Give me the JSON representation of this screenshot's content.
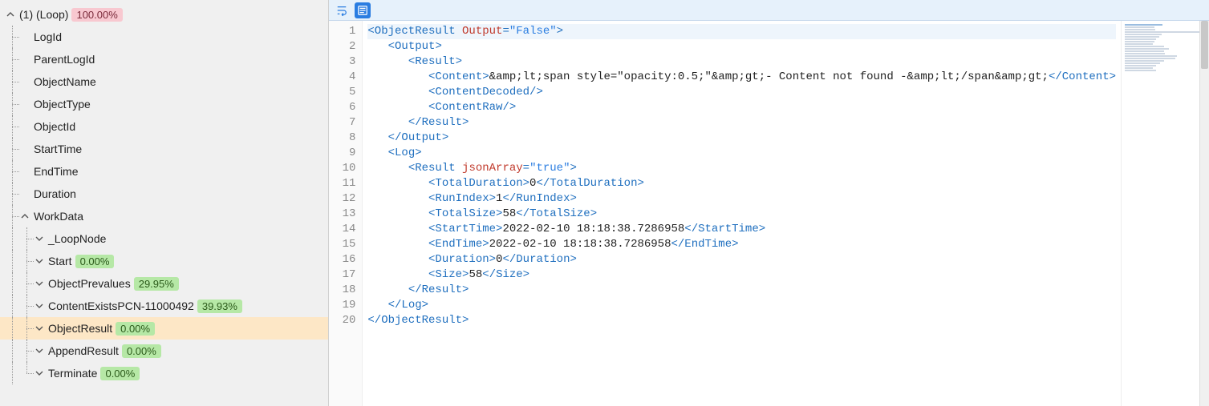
{
  "tree": {
    "root": {
      "label": "(1) (Loop)",
      "badge": {
        "text": "100.00%",
        "color": "pink"
      },
      "expanded": true
    },
    "children_flat": [
      {
        "label": "LogId"
      },
      {
        "label": "ParentLogId"
      },
      {
        "label": "ObjectName"
      },
      {
        "label": "ObjectType"
      },
      {
        "label": "ObjectId"
      },
      {
        "label": "StartTime"
      },
      {
        "label": "EndTime"
      },
      {
        "label": "Duration"
      }
    ],
    "workdata": {
      "label": "WorkData",
      "expanded": true,
      "items": [
        {
          "label": "_LoopNode",
          "collapsed": true
        },
        {
          "label": "Start",
          "badge": {
            "text": "0.00%",
            "color": "green"
          },
          "collapsed": true
        },
        {
          "label": "ObjectPrevalues",
          "badge": {
            "text": "29.95%",
            "color": "green"
          },
          "collapsed": true
        },
        {
          "label": "ContentExistsPCN-11000492",
          "badge": {
            "text": "39.93%",
            "color": "green"
          },
          "collapsed": true
        },
        {
          "label": "ObjectResult",
          "badge": {
            "text": "0.00%",
            "color": "green"
          },
          "collapsed": true,
          "selected": true
        },
        {
          "label": "AppendResult",
          "badge": {
            "text": "0.00%",
            "color": "green"
          },
          "collapsed": true
        },
        {
          "label": "Terminate",
          "badge": {
            "text": "0.00%",
            "color": "green"
          },
          "collapsed": true
        }
      ]
    }
  },
  "xml_data": {
    "ObjectResult": {
      "Output_attr": "False",
      "Output": {
        "Result": {
          "Content": "&amp;lt;span style=\"opacity:0.5;\"&amp;gt;- Content not found -&amp;lt;/span&amp;gt;",
          "ContentDecoded": null,
          "ContentRaw": null
        }
      },
      "Log": {
        "Result": {
          "jsonArray_attr": "true",
          "TotalDuration": "0",
          "RunIndex": "1",
          "TotalSize": "58",
          "StartTime": "2022-02-10 18:18:38.7286958",
          "EndTime": "2022-02-10 18:18:38.7286958",
          "Duration": "0",
          "Size": "58"
        }
      }
    }
  },
  "editor": {
    "line_count": 20,
    "lines_tokens": [
      [
        [
          "br",
          "<"
        ],
        [
          "tag",
          "ObjectResult"
        ],
        [
          "text",
          " "
        ],
        [
          "attr",
          "Output"
        ],
        [
          "br",
          "="
        ],
        [
          "str",
          "\"False\""
        ],
        [
          "br",
          ">"
        ]
      ],
      [
        [
          "text",
          "   "
        ],
        [
          "br",
          "<"
        ],
        [
          "tag",
          "Output"
        ],
        [
          "br",
          ">"
        ]
      ],
      [
        [
          "text",
          "      "
        ],
        [
          "br",
          "<"
        ],
        [
          "tag",
          "Result"
        ],
        [
          "br",
          ">"
        ]
      ],
      [
        [
          "text",
          "         "
        ],
        [
          "br",
          "<"
        ],
        [
          "tag",
          "Content"
        ],
        [
          "br",
          ">"
        ],
        [
          "text",
          "&amp;lt;span style=\"opacity:0.5;\"&amp;gt;- Content not found -&amp;lt;/span&amp;gt;"
        ],
        [
          "br",
          "</"
        ],
        [
          "tag",
          "Content"
        ],
        [
          "br",
          ">"
        ]
      ],
      [
        [
          "text",
          "         "
        ],
        [
          "br",
          "<"
        ],
        [
          "tag",
          "ContentDecoded"
        ],
        [
          "br",
          "/>"
        ]
      ],
      [
        [
          "text",
          "         "
        ],
        [
          "br",
          "<"
        ],
        [
          "tag",
          "ContentRaw"
        ],
        [
          "br",
          "/>"
        ]
      ],
      [
        [
          "text",
          "      "
        ],
        [
          "br",
          "</"
        ],
        [
          "tag",
          "Result"
        ],
        [
          "br",
          ">"
        ]
      ],
      [
        [
          "text",
          "   "
        ],
        [
          "br",
          "</"
        ],
        [
          "tag",
          "Output"
        ],
        [
          "br",
          ">"
        ]
      ],
      [
        [
          "text",
          "   "
        ],
        [
          "br",
          "<"
        ],
        [
          "tag",
          "Log"
        ],
        [
          "br",
          ">"
        ]
      ],
      [
        [
          "text",
          "      "
        ],
        [
          "br",
          "<"
        ],
        [
          "tag",
          "Result"
        ],
        [
          "text",
          " "
        ],
        [
          "attr",
          "jsonArray"
        ],
        [
          "br",
          "="
        ],
        [
          "str",
          "\"true\""
        ],
        [
          "br",
          ">"
        ]
      ],
      [
        [
          "text",
          "         "
        ],
        [
          "br",
          "<"
        ],
        [
          "tag",
          "TotalDuration"
        ],
        [
          "br",
          ">"
        ],
        [
          "text",
          "0"
        ],
        [
          "br",
          "</"
        ],
        [
          "tag",
          "TotalDuration"
        ],
        [
          "br",
          ">"
        ]
      ],
      [
        [
          "text",
          "         "
        ],
        [
          "br",
          "<"
        ],
        [
          "tag",
          "RunIndex"
        ],
        [
          "br",
          ">"
        ],
        [
          "text",
          "1"
        ],
        [
          "br",
          "</"
        ],
        [
          "tag",
          "RunIndex"
        ],
        [
          "br",
          ">"
        ]
      ],
      [
        [
          "text",
          "         "
        ],
        [
          "br",
          "<"
        ],
        [
          "tag",
          "TotalSize"
        ],
        [
          "br",
          ">"
        ],
        [
          "text",
          "58"
        ],
        [
          "br",
          "</"
        ],
        [
          "tag",
          "TotalSize"
        ],
        [
          "br",
          ">"
        ]
      ],
      [
        [
          "text",
          "         "
        ],
        [
          "br",
          "<"
        ],
        [
          "tag",
          "StartTime"
        ],
        [
          "br",
          ">"
        ],
        [
          "text",
          "2022-02-10 18:18:38.7286958"
        ],
        [
          "br",
          "</"
        ],
        [
          "tag",
          "StartTime"
        ],
        [
          "br",
          ">"
        ]
      ],
      [
        [
          "text",
          "         "
        ],
        [
          "br",
          "<"
        ],
        [
          "tag",
          "EndTime"
        ],
        [
          "br",
          ">"
        ],
        [
          "text",
          "2022-02-10 18:18:38.7286958"
        ],
        [
          "br",
          "</"
        ],
        [
          "tag",
          "EndTime"
        ],
        [
          "br",
          ">"
        ]
      ],
      [
        [
          "text",
          "         "
        ],
        [
          "br",
          "<"
        ],
        [
          "tag",
          "Duration"
        ],
        [
          "br",
          ">"
        ],
        [
          "text",
          "0"
        ],
        [
          "br",
          "</"
        ],
        [
          "tag",
          "Duration"
        ],
        [
          "br",
          ">"
        ]
      ],
      [
        [
          "text",
          "         "
        ],
        [
          "br",
          "<"
        ],
        [
          "tag",
          "Size"
        ],
        [
          "br",
          ">"
        ],
        [
          "text",
          "58"
        ],
        [
          "br",
          "</"
        ],
        [
          "tag",
          "Size"
        ],
        [
          "br",
          ">"
        ]
      ],
      [
        [
          "text",
          "      "
        ],
        [
          "br",
          "</"
        ],
        [
          "tag",
          "Result"
        ],
        [
          "br",
          ">"
        ]
      ],
      [
        [
          "text",
          "   "
        ],
        [
          "br",
          "</"
        ],
        [
          "tag",
          "Log"
        ],
        [
          "br",
          ">"
        ]
      ],
      [
        [
          "br",
          "</"
        ],
        [
          "tag",
          "ObjectResult"
        ],
        [
          "br",
          ">"
        ]
      ]
    ]
  }
}
